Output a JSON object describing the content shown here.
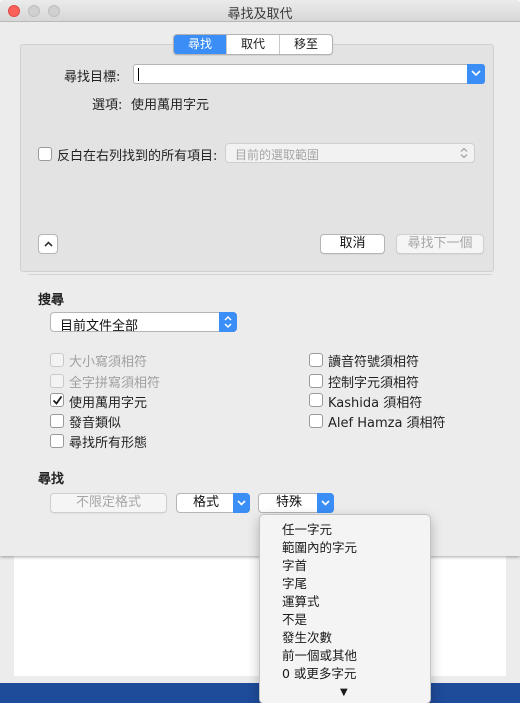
{
  "window": {
    "title": "尋找及取代"
  },
  "tabs": [
    {
      "label": "尋找",
      "active": true
    },
    {
      "label": "取代",
      "active": false
    },
    {
      "label": "移至",
      "active": false
    }
  ],
  "find": {
    "label": "尋找目標:",
    "value": "",
    "options_label": "選項:",
    "options_value": "使用萬用字元"
  },
  "highlight": {
    "label": "反白在右列找到的所有項目:",
    "checked": false,
    "dropdown_value": "目前的選取範圍"
  },
  "buttons": {
    "cancel": "取消",
    "find_next": "尋找下一個",
    "no_format": "不限定格式",
    "format": "格式",
    "special": "特殊"
  },
  "search": {
    "label": "搜尋",
    "scope": "目前文件全部"
  },
  "checkboxes_left": [
    {
      "label": "大小寫須相符",
      "checked": false,
      "enabled": false
    },
    {
      "label": "全字拼寫須相符",
      "checked": false,
      "enabled": false
    },
    {
      "label": "使用萬用字元",
      "checked": true,
      "enabled": true
    },
    {
      "label": "發音類似",
      "checked": false,
      "enabled": true
    },
    {
      "label": "尋找所有形態",
      "checked": false,
      "enabled": true
    }
  ],
  "checkboxes_right": [
    {
      "label": "讀音符號須相符",
      "checked": false,
      "enabled": true
    },
    {
      "label": "控制字元須相符",
      "checked": false,
      "enabled": true
    },
    {
      "label": "Kashida 須相符",
      "checked": false,
      "enabled": true
    },
    {
      "label": "Alef Hamza 須相符",
      "checked": false,
      "enabled": true
    }
  ],
  "find_section": {
    "label": "尋找"
  },
  "special_menu": {
    "items": [
      "任一字元",
      "範圍內的字元",
      "字首",
      "字尾",
      "運算式",
      "不是",
      "發生次數",
      "前一個或其他",
      "0 或更多字元"
    ],
    "more_indicator": "▼"
  },
  "colors": {
    "accent": "#3a8ef6",
    "close": "#fc605b",
    "taskbar": "#1e4b9a"
  }
}
